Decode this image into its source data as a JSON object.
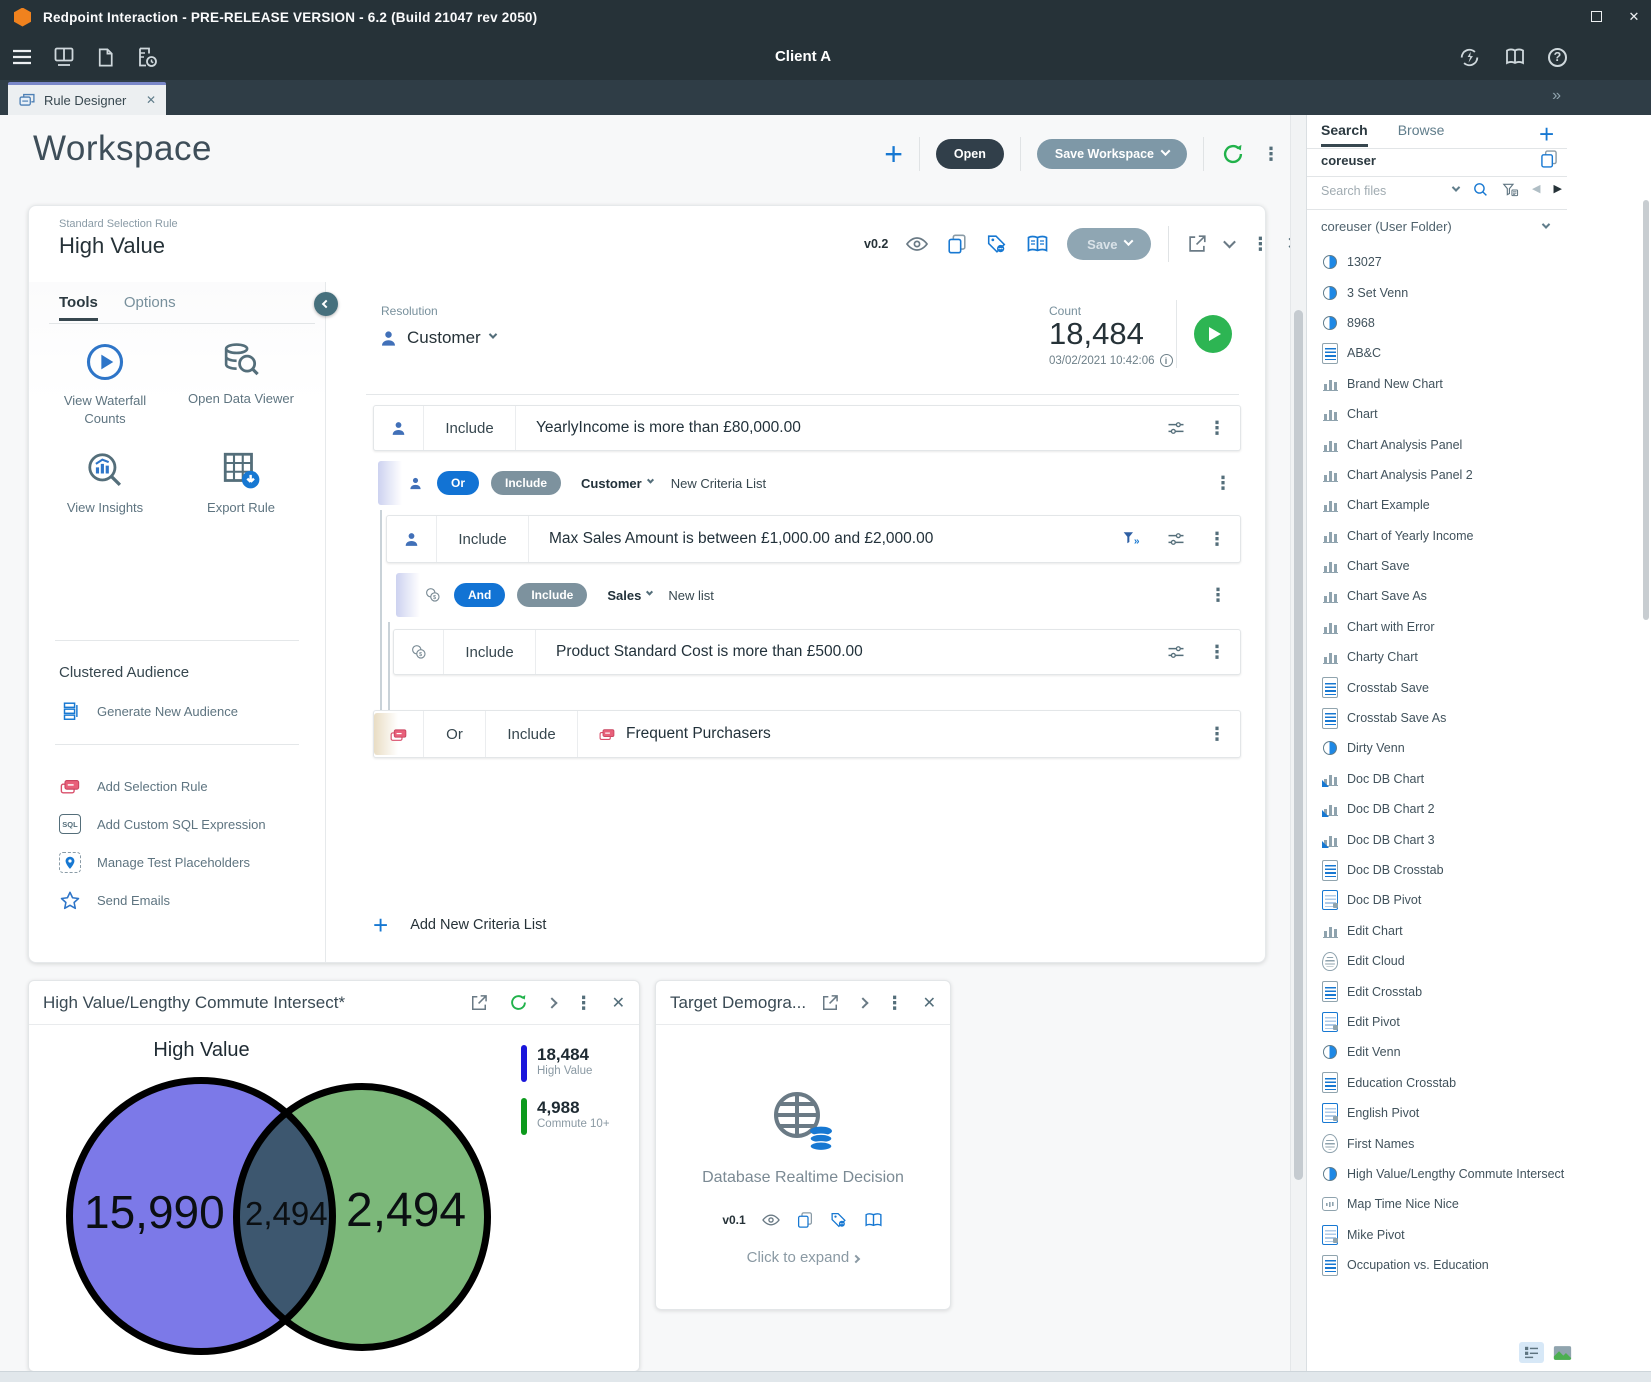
{
  "colors": {
    "titlebar_bg": "#263238",
    "brand_orange": "#F0821E",
    "accent_blue": "#1778D2",
    "green": "#21B24B",
    "pill_blue": "#1273D4",
    "pill_gray": "#7D929E",
    "venn_left": "#7C79E8",
    "venn_right": "#7CB87A",
    "legend_blue": "#1A16DB",
    "legend_green": "#0C9A1C"
  },
  "titlebar": {
    "title": "Redpoint Interaction - PRE-RELEASE VERSION - 6.2 (Build 21047 rev 2050)"
  },
  "appbar": {
    "client_name": "Client A"
  },
  "tabstrip": {
    "active_tab": "Rule Designer"
  },
  "workspace": {
    "title": "Workspace",
    "open_button": "Open",
    "save_workspace_button": "Save Workspace"
  },
  "rule_card": {
    "type_label": "Standard Selection Rule",
    "name": "High Value",
    "version": "v0.2",
    "save_button": "Save",
    "tabs": {
      "tools": "Tools",
      "options": "Options"
    },
    "tools": [
      {
        "label": "View Waterfall Counts",
        "icon": "play-circle"
      },
      {
        "label": "Open Data Viewer",
        "icon": "database-search"
      },
      {
        "label": "View Insights",
        "icon": "insights-magnifier"
      },
      {
        "label": "Export Rule",
        "icon": "table-download"
      }
    ],
    "clustered_audience_heading": "Clustered Audience",
    "generate_new_audience": "Generate New Audience",
    "actions": [
      {
        "label": "Add Selection Rule",
        "icon": "selection-cards"
      },
      {
        "label": "Add Custom SQL Expression",
        "icon": "sql-badge"
      },
      {
        "label": "Manage Test Placeholders",
        "icon": "placeholder-pin"
      },
      {
        "label": "Send Emails",
        "icon": "star"
      }
    ],
    "resolution_label": "Resolution",
    "resolution_value": "Customer",
    "count_label": "Count",
    "count_value": "18,484",
    "count_timestamp": "03/02/2021 10:42:06",
    "criteria": [
      {
        "row": "rule",
        "operator": "Include",
        "text": "YearlyIncome is more than £80,000.00"
      },
      {
        "row": "group",
        "conjunction": "Or",
        "operator": "Include",
        "scope": "Customer",
        "name": "New Criteria List"
      },
      {
        "row": "rule",
        "operator": "Include",
        "text": "Max Sales Amount is between £1,000.00 and £2,000.00"
      },
      {
        "row": "group",
        "conjunction": "And",
        "operator": "Include",
        "scope": "Sales",
        "name": "New list"
      },
      {
        "row": "rule",
        "operator": "Include",
        "text": "Product Standard Cost is more than £500.00"
      },
      {
        "row": "audience",
        "conjunction": "Or",
        "operator": "Include",
        "text": "Frequent Purchasers"
      }
    ],
    "add_new_criteria": "Add New Criteria List"
  },
  "venn_panel": {
    "title": "High Value/Lengthy Commute Intersect*",
    "set_label": "High Value",
    "left_value": "15,990",
    "intersect_value": "2,494",
    "right_value": "2,494",
    "legend": [
      {
        "value": "18,484",
        "label": "High Value"
      },
      {
        "value": "4,988",
        "label": "Commute 10+"
      }
    ]
  },
  "chart_data": {
    "type": "venn",
    "title": "High Value/Lengthy Commute Intersect*",
    "sets": [
      {
        "label": "High Value",
        "total": 18484,
        "exclusive": 15990,
        "color": "#7C79E8"
      },
      {
        "label": "Commute 10+",
        "total": 4988,
        "exclusive": 2494,
        "color": "#7CB87A"
      }
    ],
    "intersection": 2494
  },
  "target_panel": {
    "title": "Target Demogra...",
    "placeholder_label": "Database Realtime Decision",
    "version": "v0.1",
    "expand_label": "Click to expand"
  },
  "sidebar": {
    "tabs": {
      "search": "Search",
      "browse": "Browse"
    },
    "search_value": "coreuser",
    "files_placeholder": "Search files",
    "folder_label": "coreuser (User Folder)",
    "items": [
      {
        "label": "13027",
        "icon": "venn"
      },
      {
        "label": "3 Set Venn",
        "icon": "venn"
      },
      {
        "label": "8968",
        "icon": "venn"
      },
      {
        "label": "AB&C",
        "icon": "doc"
      },
      {
        "label": "Brand New Chart",
        "icon": "chart"
      },
      {
        "label": "Chart",
        "icon": "chart"
      },
      {
        "label": "Chart Analysis Panel",
        "icon": "chart"
      },
      {
        "label": "Chart Analysis Panel 2",
        "icon": "chart"
      },
      {
        "label": "Chart Example",
        "icon": "chart"
      },
      {
        "label": "Chart of Yearly Income",
        "icon": "chart"
      },
      {
        "label": "Chart Save",
        "icon": "chart"
      },
      {
        "label": "Chart Save As",
        "icon": "chart"
      },
      {
        "label": "Chart with Error",
        "icon": "chart"
      },
      {
        "label": "Charty Chart",
        "icon": "chart"
      },
      {
        "label": "Crosstab Save",
        "icon": "doc"
      },
      {
        "label": "Crosstab Save As",
        "icon": "doc"
      },
      {
        "label": "Dirty Venn",
        "icon": "venn"
      },
      {
        "label": "Doc DB Chart",
        "icon": "chart-db"
      },
      {
        "label": "Doc DB Chart 2",
        "icon": "chart-db"
      },
      {
        "label": "Doc DB Chart 3",
        "icon": "chart-db"
      },
      {
        "label": "Doc DB Crosstab",
        "icon": "doc"
      },
      {
        "label": "Doc DB Pivot",
        "icon": "pivot"
      },
      {
        "label": "Edit Chart",
        "icon": "chart"
      },
      {
        "label": "Edit Cloud",
        "icon": "cloud"
      },
      {
        "label": "Edit Crosstab",
        "icon": "doc"
      },
      {
        "label": "Edit Pivot",
        "icon": "pivot"
      },
      {
        "label": "Edit Venn",
        "icon": "venn"
      },
      {
        "label": "Education Crosstab",
        "icon": "doc"
      },
      {
        "label": "English Pivot",
        "icon": "pivot"
      },
      {
        "label": "First Names",
        "icon": "cloud"
      },
      {
        "label": "High Value/Lengthy Commute Intersect",
        "icon": "venn"
      },
      {
        "label": "Map Time Nice Nice",
        "icon": "map"
      },
      {
        "label": "Mike Pivot",
        "icon": "pivot"
      },
      {
        "label": "Occupation vs. Education",
        "icon": "doc"
      }
    ]
  }
}
